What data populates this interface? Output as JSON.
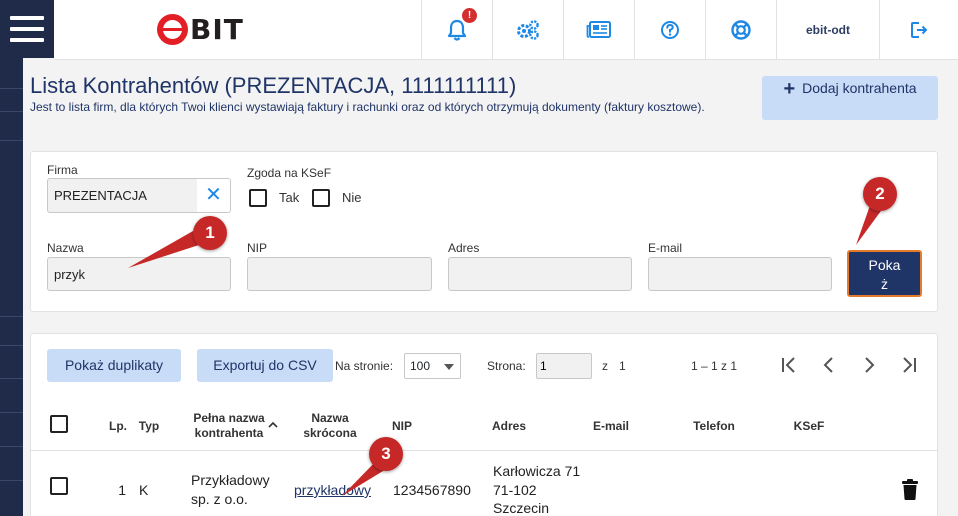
{
  "header": {
    "logo_text": "BIT",
    "notifications_badge": "!",
    "user": "ebit-odt"
  },
  "page": {
    "title": "Lista Kontrahentów (PREZENTACJA, 1111111111)",
    "subtitle": "Jest to lista firm, dla których Twoi klienci wystawiają faktury i rachunki oraz od których otrzymują dokumenty (faktury kosztowe).",
    "add_button": {
      "icon": "+",
      "label": "Dodaj kontrahenta"
    }
  },
  "filters": {
    "firma": {
      "label": "Firma",
      "value": "PREZENTACJA"
    },
    "ksef": {
      "label": "Zgoda na KSeF",
      "yes": "Tak",
      "no": "Nie"
    },
    "nazwa": {
      "label": "Nazwa",
      "value": "przyk"
    },
    "nip": {
      "label": "NIP",
      "value": ""
    },
    "adres": {
      "label": "Adres",
      "value": ""
    },
    "email": {
      "label": "E-mail",
      "value": ""
    },
    "show_button": "Pokaż"
  },
  "toolbar": {
    "duplicates": "Pokaż duplikaty",
    "export_csv": "Exportuj do CSV",
    "per_page_label": "Na stronie:",
    "per_page_value": "100",
    "page_label": "Strona:",
    "page_value": "1",
    "of_label": "z",
    "of_value": "1",
    "range": "1 – 1 z 1"
  },
  "table": {
    "headers": {
      "lp": "Lp.",
      "typ": "Typ",
      "full_name": "Pełna nazwa kontrahenta",
      "short_name": "Nazwa skrócona",
      "nip": "NIP",
      "adres": "Adres",
      "email": "E-mail",
      "telefon": "Telefon",
      "ksef": "KSeF"
    },
    "rows": [
      {
        "lp": "1",
        "typ": "K",
        "full_name": "Przykładowy sp. z o.o.",
        "short_name": "przykładowy",
        "nip": "1234567890",
        "adres_street": "Karłowicza 71",
        "adres_postal": "71-102",
        "adres_city": "Szczecin",
        "email": "",
        "telefon": "",
        "ksef": ""
      }
    ]
  },
  "annotations": {
    "m1": "1",
    "m2": "2",
    "m3": "3",
    "color": "#c62828"
  },
  "colors": {
    "navy": "#1f3467",
    "accent": "#1e88e5",
    "button_light": "#c8dcf7",
    "show_border": "#e57a2b"
  }
}
